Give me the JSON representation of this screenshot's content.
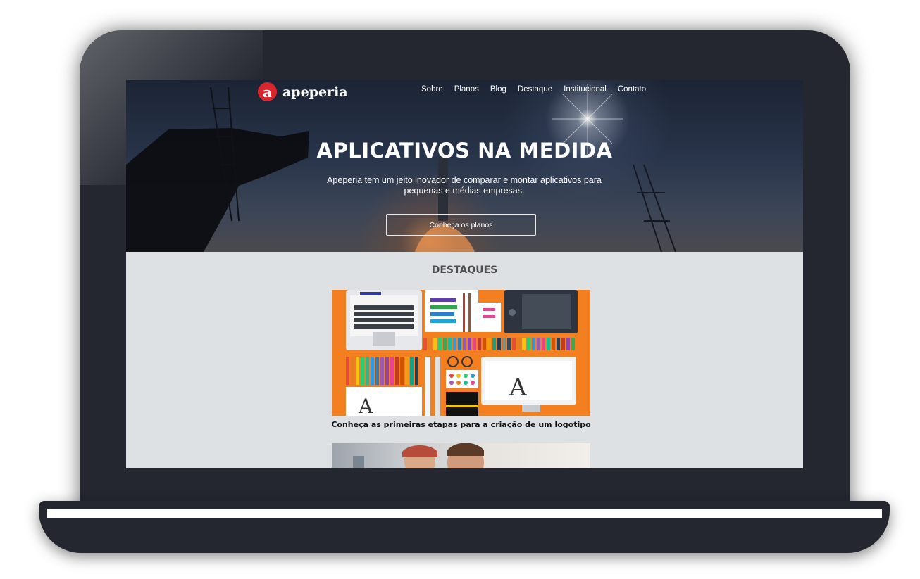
{
  "brand": {
    "logo_letter": "a",
    "name": "apeperia",
    "accent_color": "#d7262e"
  },
  "nav": {
    "items": [
      "Sobre",
      "Planos",
      "Blog",
      "Destaque",
      "Institucional",
      "Contato"
    ]
  },
  "hero": {
    "title": "APLICATIVOS NA MEDIDA",
    "subtitle": "Apeperia tem um jeito inovador de comparar e montar aplicativos para pequenas e médias empresas.",
    "cta_label": "Conheça os planos"
  },
  "highlights": {
    "title": "DESTAQUES",
    "items": [
      {
        "title": "Conheça as primeiras etapas para a criação de um logotipo"
      }
    ]
  },
  "colors": {
    "laptop_body": "#242730",
    "screen_bg": "#dde1e4",
    "card_orange": "#f47f20"
  }
}
